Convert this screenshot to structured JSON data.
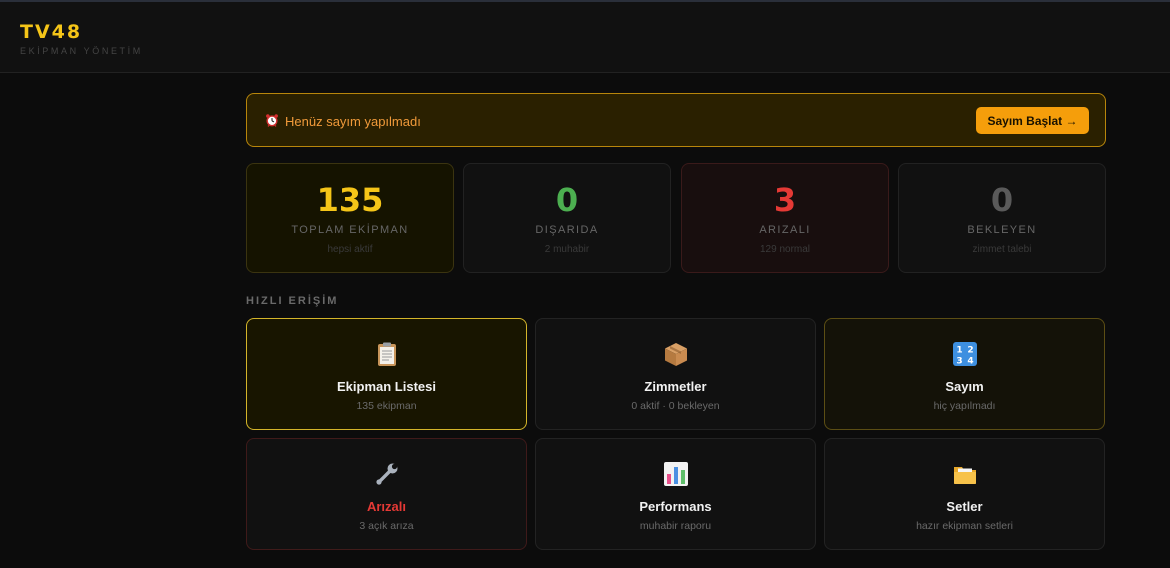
{
  "header": {
    "logo": "TV48",
    "subtitle": "EKİPMAN YÖNETİM"
  },
  "banner": {
    "icon": "alarm-clock-icon",
    "message": "Henüz sayım yapılmadı",
    "button_label": "Sayım Başlat →"
  },
  "stats": [
    {
      "value": "135",
      "label": "TOPLAM EKİPMAN",
      "sub": "hepsi aktif",
      "color": "#f5c518"
    },
    {
      "value": "0",
      "label": "DIŞARIDA",
      "sub": "2 muhabir",
      "color": "#4caf50"
    },
    {
      "value": "3",
      "label": "ARIZALI",
      "sub": "129 normal",
      "color": "#e53935"
    },
    {
      "value": "0",
      "label": "BEKLEYEN",
      "sub": "zimmet talebi",
      "color": "#5a5a5a"
    }
  ],
  "quick_access": {
    "title": "HIZLI ERİŞİM",
    "cards": [
      {
        "icon": "clipboard-icon",
        "title": "Ekipman Listesi",
        "sub": "135 ekipman"
      },
      {
        "icon": "package-icon",
        "title": "Zimmetler",
        "sub": "0 aktif · 0 bekleyen"
      },
      {
        "icon": "numbers-icon",
        "title": "Sayım",
        "sub": "hiç yapılmadı"
      },
      {
        "icon": "wrench-icon",
        "title": "Arızalı",
        "sub": "3 açık arıza",
        "title_color": "#e53935"
      },
      {
        "icon": "bar-chart-icon",
        "title": "Performans",
        "sub": "muhabir raporu"
      },
      {
        "icon": "folder-icon",
        "title": "Setler",
        "sub": "hazır ekipman setleri"
      }
    ]
  },
  "colors": {
    "accent": "#f5c518",
    "banner_button": "#f59e0b",
    "danger": "#e53935",
    "success": "#4caf50"
  }
}
